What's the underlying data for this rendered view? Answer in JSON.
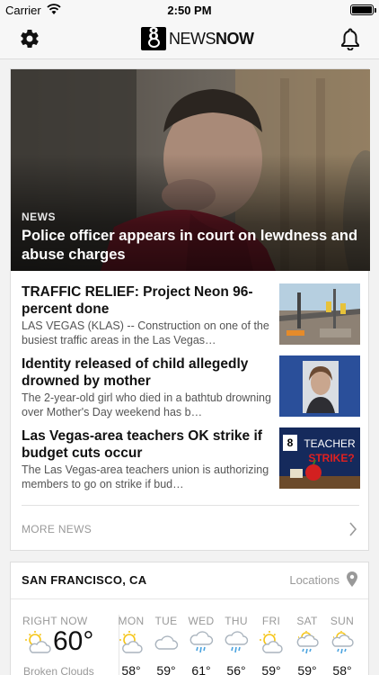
{
  "status_bar": {
    "carrier": "Carrier",
    "time": "2:50 PM"
  },
  "header": {
    "logo_number": "8",
    "logo_news": "NEWS",
    "logo_now": "NOW"
  },
  "featured": {
    "category": "NEWS",
    "headline": "Police officer appears in court on lewdness and abuse charges"
  },
  "articles": [
    {
      "title": "TRAFFIC RELIEF: Project Neon 96-percent done",
      "summary": "LAS VEGAS (KLAS) -- Construction on one of the busiest traffic areas in the Las Vegas…"
    },
    {
      "title": "Identity released of child allegedly drowned by mother",
      "summary": "The 2-year-old girl who died in a bathtub drowning over Mother's Day weekend has b…"
    },
    {
      "title": "Las Vegas-area teachers OK strike if budget cuts occur",
      "summary": "The Las Vegas-area teachers union is authorizing members to go on strike if bud…",
      "thumb_text": "TEACHER STRIKE?"
    }
  ],
  "more_news": "MORE NEWS",
  "weather": {
    "city": "SAN FRANCISCO, CA",
    "locations_label": "Locations",
    "now_label": "RIGHT NOW",
    "now_temp": "60°",
    "now_condition": "Broken Clouds",
    "now_icon": "partly-cloudy-icon",
    "days": [
      {
        "name": "MON",
        "hi": "58°",
        "icon": "partly-cloudy-icon"
      },
      {
        "name": "TUE",
        "hi": "59°",
        "icon": "cloud-icon"
      },
      {
        "name": "WED",
        "hi": "61°",
        "icon": "rain-icon"
      },
      {
        "name": "THU",
        "hi": "56°",
        "icon": "rain-icon"
      },
      {
        "name": "FRI",
        "hi": "59°",
        "icon": "partly-cloudy-icon"
      },
      {
        "name": "SAT",
        "hi": "59°",
        "icon": "rain-sun-icon"
      },
      {
        "name": "SUN",
        "hi": "58°",
        "icon": "rain-sun-icon"
      }
    ]
  },
  "colors": {
    "accent_sun": "#f5c518",
    "rain": "#4aa3df",
    "cloud_outline": "#aab4be"
  }
}
